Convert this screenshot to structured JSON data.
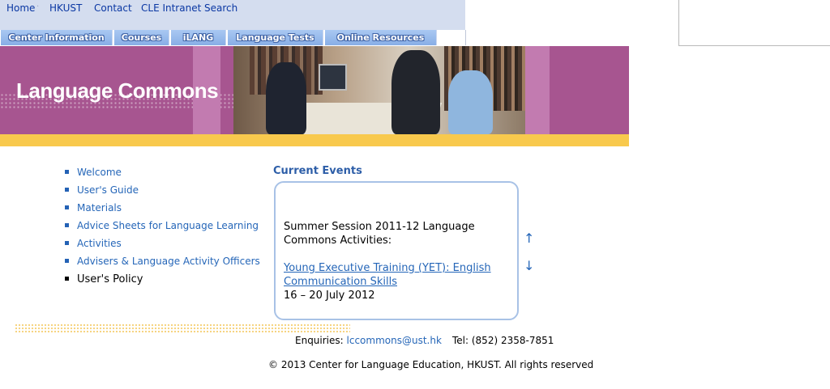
{
  "top_links": [
    "Home",
    "HKUST",
    "Contact",
    "CLE Intranet",
    "Search"
  ],
  "tabs": [
    "Center Information",
    "Courses",
    "iLANG",
    "Language Tests",
    "Online Resources"
  ],
  "banner": {
    "title": "Language Commons"
  },
  "menu": [
    "Welcome",
    "User's Guide",
    "Materials",
    "Advice Sheets for Language Learning",
    "Activities",
    "Advisers & Language Activity Officers",
    "User's Policy"
  ],
  "current_events": {
    "title": "Current Events",
    "intro": "Summer Session 2011-12 Language Commons Activities:",
    "event_link": "Young Executive Training (YET): English Communication Skills",
    "event_date": "16 – 20 July 2012",
    "arrow_up": "↑",
    "arrow_down": "↓"
  },
  "footer": {
    "enquiries_label": "Enquiries:",
    "email": "lccommons@ust.hk",
    "tel": "Tel: (852) 2358-7851",
    "copyright": "© 2013 Center for Language Education, HKUST. All rights reserved"
  },
  "colors": {
    "banner_purple": "#a75590",
    "accent_yellow": "#f8c94d",
    "link_blue": "#2566b8",
    "tab_blue": "#88aee6"
  }
}
